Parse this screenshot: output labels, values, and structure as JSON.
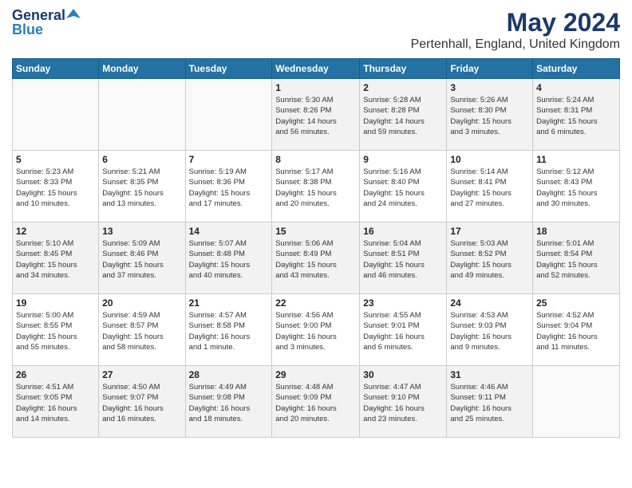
{
  "header": {
    "logo_general": "General",
    "logo_blue": "Blue",
    "title": "May 2024",
    "subtitle": "Pertenhall, England, United Kingdom"
  },
  "days_of_week": [
    "Sunday",
    "Monday",
    "Tuesday",
    "Wednesday",
    "Thursday",
    "Friday",
    "Saturday"
  ],
  "weeks": [
    [
      {
        "day": "",
        "info": ""
      },
      {
        "day": "",
        "info": ""
      },
      {
        "day": "",
        "info": ""
      },
      {
        "day": "1",
        "info": "Sunrise: 5:30 AM\nSunset: 8:26 PM\nDaylight: 14 hours\nand 56 minutes."
      },
      {
        "day": "2",
        "info": "Sunrise: 5:28 AM\nSunset: 8:28 PM\nDaylight: 14 hours\nand 59 minutes."
      },
      {
        "day": "3",
        "info": "Sunrise: 5:26 AM\nSunset: 8:30 PM\nDaylight: 15 hours\nand 3 minutes."
      },
      {
        "day": "4",
        "info": "Sunrise: 5:24 AM\nSunset: 8:31 PM\nDaylight: 15 hours\nand 6 minutes."
      }
    ],
    [
      {
        "day": "5",
        "info": "Sunrise: 5:23 AM\nSunset: 8:33 PM\nDaylight: 15 hours\nand 10 minutes."
      },
      {
        "day": "6",
        "info": "Sunrise: 5:21 AM\nSunset: 8:35 PM\nDaylight: 15 hours\nand 13 minutes."
      },
      {
        "day": "7",
        "info": "Sunrise: 5:19 AM\nSunset: 8:36 PM\nDaylight: 15 hours\nand 17 minutes."
      },
      {
        "day": "8",
        "info": "Sunrise: 5:17 AM\nSunset: 8:38 PM\nDaylight: 15 hours\nand 20 minutes."
      },
      {
        "day": "9",
        "info": "Sunrise: 5:16 AM\nSunset: 8:40 PM\nDaylight: 15 hours\nand 24 minutes."
      },
      {
        "day": "10",
        "info": "Sunrise: 5:14 AM\nSunset: 8:41 PM\nDaylight: 15 hours\nand 27 minutes."
      },
      {
        "day": "11",
        "info": "Sunrise: 5:12 AM\nSunset: 8:43 PM\nDaylight: 15 hours\nand 30 minutes."
      }
    ],
    [
      {
        "day": "12",
        "info": "Sunrise: 5:10 AM\nSunset: 8:45 PM\nDaylight: 15 hours\nand 34 minutes."
      },
      {
        "day": "13",
        "info": "Sunrise: 5:09 AM\nSunset: 8:46 PM\nDaylight: 15 hours\nand 37 minutes."
      },
      {
        "day": "14",
        "info": "Sunrise: 5:07 AM\nSunset: 8:48 PM\nDaylight: 15 hours\nand 40 minutes."
      },
      {
        "day": "15",
        "info": "Sunrise: 5:06 AM\nSunset: 8:49 PM\nDaylight: 15 hours\nand 43 minutes."
      },
      {
        "day": "16",
        "info": "Sunrise: 5:04 AM\nSunset: 8:51 PM\nDaylight: 15 hours\nand 46 minutes."
      },
      {
        "day": "17",
        "info": "Sunrise: 5:03 AM\nSunset: 8:52 PM\nDaylight: 15 hours\nand 49 minutes."
      },
      {
        "day": "18",
        "info": "Sunrise: 5:01 AM\nSunset: 8:54 PM\nDaylight: 15 hours\nand 52 minutes."
      }
    ],
    [
      {
        "day": "19",
        "info": "Sunrise: 5:00 AM\nSunset: 8:55 PM\nDaylight: 15 hours\nand 55 minutes."
      },
      {
        "day": "20",
        "info": "Sunrise: 4:59 AM\nSunset: 8:57 PM\nDaylight: 15 hours\nand 58 minutes."
      },
      {
        "day": "21",
        "info": "Sunrise: 4:57 AM\nSunset: 8:58 PM\nDaylight: 16 hours\nand 1 minute."
      },
      {
        "day": "22",
        "info": "Sunrise: 4:56 AM\nSunset: 9:00 PM\nDaylight: 16 hours\nand 3 minutes."
      },
      {
        "day": "23",
        "info": "Sunrise: 4:55 AM\nSunset: 9:01 PM\nDaylight: 16 hours\nand 6 minutes."
      },
      {
        "day": "24",
        "info": "Sunrise: 4:53 AM\nSunset: 9:03 PM\nDaylight: 16 hours\nand 9 minutes."
      },
      {
        "day": "25",
        "info": "Sunrise: 4:52 AM\nSunset: 9:04 PM\nDaylight: 16 hours\nand 11 minutes."
      }
    ],
    [
      {
        "day": "26",
        "info": "Sunrise: 4:51 AM\nSunset: 9:05 PM\nDaylight: 16 hours\nand 14 minutes."
      },
      {
        "day": "27",
        "info": "Sunrise: 4:50 AM\nSunset: 9:07 PM\nDaylight: 16 hours\nand 16 minutes."
      },
      {
        "day": "28",
        "info": "Sunrise: 4:49 AM\nSunset: 9:08 PM\nDaylight: 16 hours\nand 18 minutes."
      },
      {
        "day": "29",
        "info": "Sunrise: 4:48 AM\nSunset: 9:09 PM\nDaylight: 16 hours\nand 20 minutes."
      },
      {
        "day": "30",
        "info": "Sunrise: 4:47 AM\nSunset: 9:10 PM\nDaylight: 16 hours\nand 23 minutes."
      },
      {
        "day": "31",
        "info": "Sunrise: 4:46 AM\nSunset: 9:11 PM\nDaylight: 16 hours\nand 25 minutes."
      },
      {
        "day": "",
        "info": ""
      }
    ]
  ]
}
